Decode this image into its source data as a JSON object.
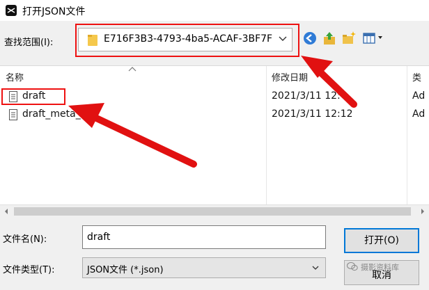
{
  "window": {
    "title": "打开JSON文件"
  },
  "lookin": {
    "label": "查找范围(I):",
    "folder": "E716F3B3-4793-4ba5-ACAF-3BF7F"
  },
  "toolbar": {
    "back_icon": "back-icon",
    "up_icon": "up-folder-icon",
    "new_folder_icon": "new-folder-icon",
    "view_icon": "view-menu-icon"
  },
  "columns": {
    "name": "名称",
    "modified": "修改日期",
    "type": "类"
  },
  "files": [
    {
      "name": "draft",
      "modified": "2021/3/11 12:",
      "modified_tail": "4",
      "type": "Ad"
    },
    {
      "name": "draft_meta_",
      "modified": "2021/3/11 12:12",
      "modified_tail": "",
      "type": "Ad"
    }
  ],
  "filename": {
    "label": "文件名(N):",
    "value": "draft"
  },
  "filetype": {
    "label": "文件类型(T):",
    "value": "JSON文件 (*.json)"
  },
  "buttons": {
    "open": "打开(O)",
    "cancel": "取消"
  },
  "watermark": {
    "text": "摄影资料库"
  },
  "colors": {
    "highlight": "#e11111",
    "accent": "#0078d7"
  }
}
